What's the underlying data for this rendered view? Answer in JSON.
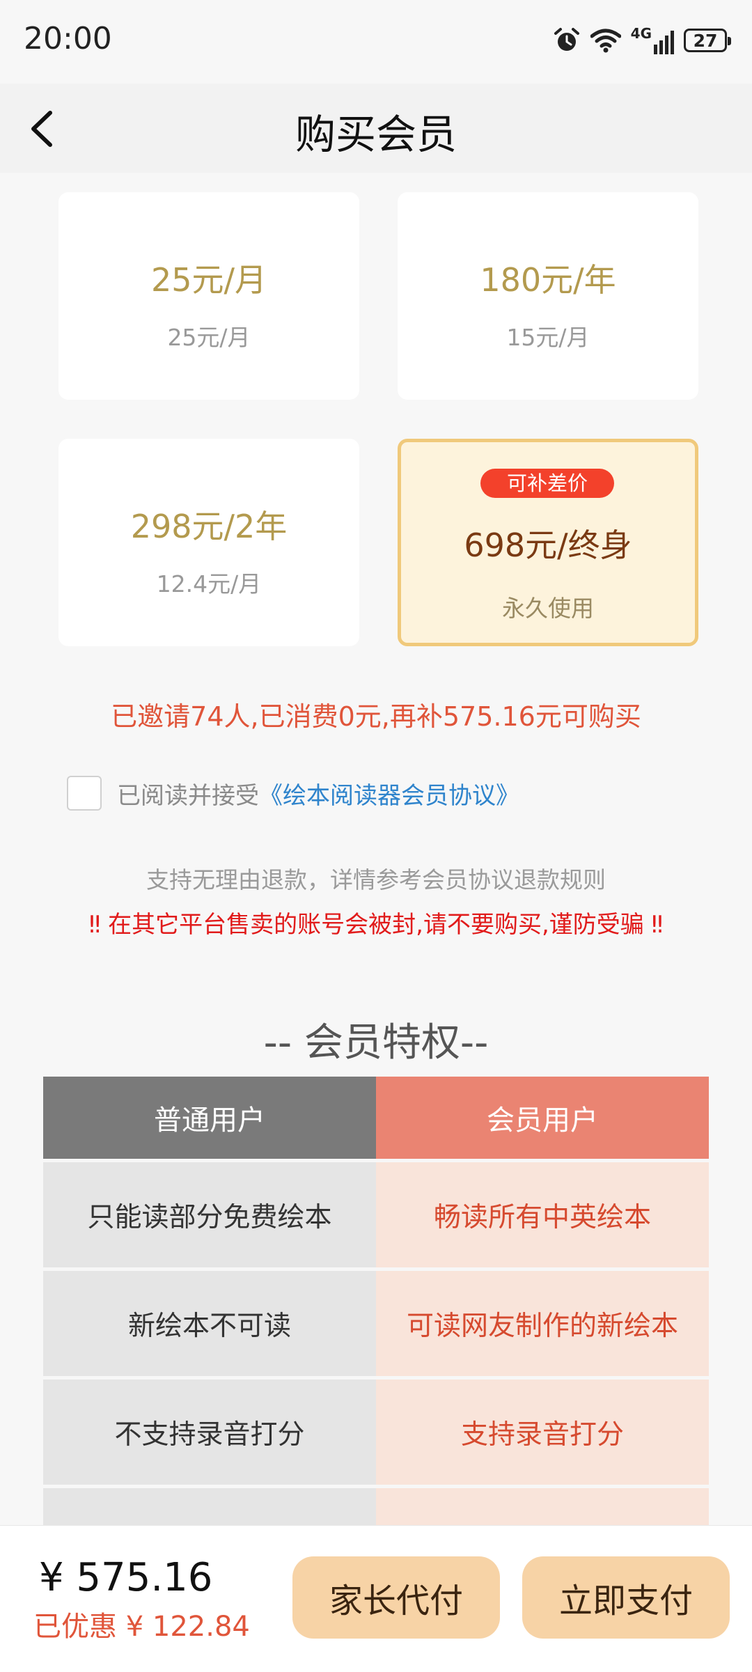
{
  "status_bar": {
    "time": "20:00",
    "network": "4G",
    "battery": "27"
  },
  "header": {
    "title": "购买会员"
  },
  "plans": [
    {
      "price": "25元/月",
      "per_month": "25元/月"
    },
    {
      "price": "180元/年",
      "per_month": "15元/月"
    },
    {
      "price": "298元/2年",
      "per_month": "12.4元/月"
    },
    {
      "badge": "可补差价",
      "price": "698元/终身",
      "per_month": "永久使用",
      "selected": true
    }
  ],
  "invite_note": "已邀请74人,已消费0元,再补575.16元可购买",
  "agreement": {
    "checked": false,
    "prefix": "已阅读并接受",
    "link": "《绘本阅读器会员协议》"
  },
  "refund_note": "支持无理由退款，详情参考会员协议退款规则",
  "warning_note": "‼ 在其它平台售卖的账号会被封,请不要购买,谨防受骗 ‼",
  "privileges": {
    "title": "-- 会员特权--",
    "headers": {
      "normal": "普通用户",
      "vip": "会员用户"
    },
    "rows": [
      {
        "normal": "只能读部分免费绘本",
        "vip": "畅读所有中英绘本"
      },
      {
        "normal": "新绘本不可读",
        "vip": "可读网友制作的新绘本"
      },
      {
        "normal": "不支持录音打分",
        "vip": "支持录音打分"
      }
    ]
  },
  "bottom": {
    "total": "¥ 575.16",
    "discount": "已优惠 ¥ 122.84",
    "parent_pay": "家长代付",
    "pay_now": "立即支付"
  },
  "colors": {
    "accent": "#e0553a",
    "gold": "#b39a4e",
    "button": "#f7d3a6"
  }
}
